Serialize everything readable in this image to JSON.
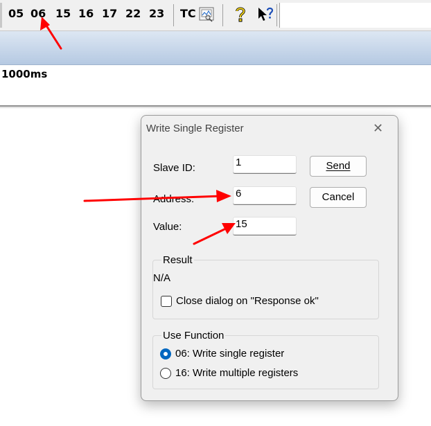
{
  "toolbar": {
    "function_codes": [
      "05",
      "06",
      "15",
      "16",
      "17",
      "22",
      "23"
    ],
    "test_center_label": "TC",
    "icons": [
      "monitor-icon",
      "help-icon",
      "context-help-icon"
    ]
  },
  "poll": {
    "interval_text": "1000ms"
  },
  "dialog": {
    "title": "Write Single Register",
    "close_glyph": "✕",
    "fields": {
      "slave_id": {
        "label": "Slave ID:",
        "value": "1"
      },
      "address": {
        "label": "Address:",
        "value": "6"
      },
      "value": {
        "label": "Value:",
        "value": "15"
      }
    },
    "buttons": {
      "send": "Send",
      "cancel": "Cancel"
    },
    "result": {
      "title": "Result",
      "status": "N/A",
      "close_on_ok_label": "Close dialog on \"Response ok\"",
      "close_on_ok_checked": false
    },
    "use_function": {
      "title": "Use Function",
      "options": [
        {
          "label": "06: Write single register",
          "selected": true
        },
        {
          "label": "16: Write multiple registers",
          "selected": false
        }
      ]
    }
  },
  "annotation_color": "#ff0000"
}
